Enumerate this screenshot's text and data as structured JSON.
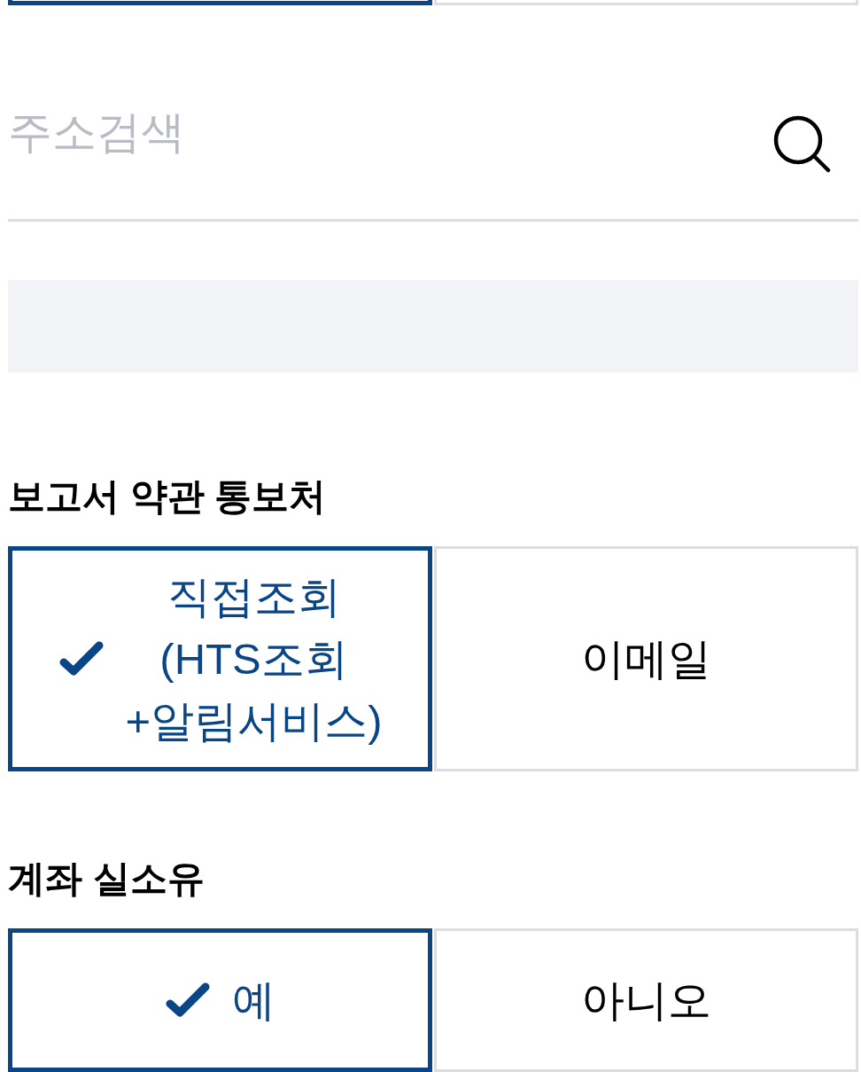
{
  "previous_options": [
    {
      "selected": true
    },
    {
      "selected": false
    }
  ],
  "address_search": {
    "placeholder": "주소검색"
  },
  "sections": [
    {
      "title": "보고서 약관 통보처",
      "options": [
        {
          "label": "직접조회\n(HTS조회\n+알림서비스)",
          "selected": true
        },
        {
          "label": "이메일",
          "selected": false
        }
      ]
    },
    {
      "title": "계좌 실소유",
      "options": [
        {
          "label": "예",
          "selected": true
        },
        {
          "label": "아니오",
          "selected": false
        }
      ]
    }
  ]
}
